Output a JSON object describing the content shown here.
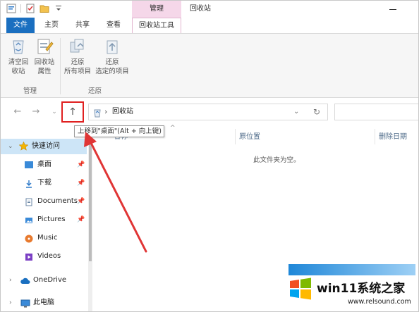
{
  "titlebar": {
    "context_tab": "管理",
    "window_title": "回收站"
  },
  "ribbon_tabs": {
    "file": "文件",
    "home": "主页",
    "share": "共享",
    "view": "查看",
    "tools": "回收站工具"
  },
  "ribbon": {
    "empty_bin": [
      "清空回",
      "收站"
    ],
    "bin_props": [
      "回收站",
      "属性"
    ],
    "group_manage": "管理",
    "restore_all": [
      "还原",
      "所有项目"
    ],
    "restore_selected": [
      "还原",
      "选定的项目"
    ],
    "group_restore": "还原"
  },
  "address": {
    "path": "回收站"
  },
  "tooltip": "上移到\"桌面\"(Alt + 向上键)",
  "navpane": {
    "quick_access": "快速访问",
    "items": [
      {
        "label": "桌面",
        "pinned": true
      },
      {
        "label": "下载",
        "pinned": true
      },
      {
        "label": "Documents",
        "pinned": true
      },
      {
        "label": "Pictures",
        "pinned": true
      },
      {
        "label": "Music",
        "pinned": false
      },
      {
        "label": "Videos",
        "pinned": false
      }
    ],
    "onedrive": "OneDrive",
    "this_pc": "此电脑"
  },
  "content": {
    "col_name": "名称",
    "col_location": "原位置",
    "col_deleted": "删除日期",
    "empty_text": "此文件夹为空。"
  },
  "watermark": {
    "title": "win11系统之家",
    "url": "www.relsound.com"
  },
  "colors": {
    "accent": "#1a6fc0",
    "context": "#f5d7e9",
    "highlight": "#e02020",
    "selected": "#cde5f7"
  }
}
